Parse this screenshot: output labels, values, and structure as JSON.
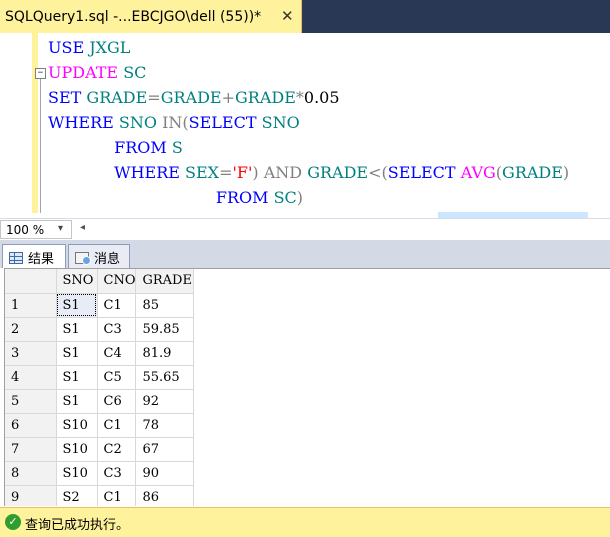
{
  "document_tab": {
    "title": "SQLQuery1.sql -...EBCJGO\\dell (55))*",
    "close_glyph": "✕"
  },
  "editor": {
    "lines": [
      [
        {
          "t": "USE",
          "c": "kw"
        },
        {
          "t": " ",
          "c": "num"
        },
        {
          "t": "JXGL",
          "c": "id"
        }
      ],
      [
        {
          "t": "UPDATE",
          "c": "fn"
        },
        {
          "t": " ",
          "c": "num"
        },
        {
          "t": "SC",
          "c": "id"
        }
      ],
      [
        {
          "t": "SET",
          "c": "kw"
        },
        {
          "t": " ",
          "c": "num"
        },
        {
          "t": "GRADE",
          "c": "id"
        },
        {
          "t": "=",
          "c": "op"
        },
        {
          "t": "GRADE",
          "c": "id"
        },
        {
          "t": "+",
          "c": "op"
        },
        {
          "t": "GRADE",
          "c": "id"
        },
        {
          "t": "*",
          "c": "op"
        },
        {
          "t": "0.05",
          "c": "num"
        }
      ],
      [
        {
          "t": "WHERE",
          "c": "kw"
        },
        {
          "t": " ",
          "c": "num"
        },
        {
          "t": "SNO",
          "c": "id"
        },
        {
          "t": " ",
          "c": "num"
        },
        {
          "t": "IN",
          "c": "op"
        },
        {
          "t": "(",
          "c": "op"
        },
        {
          "t": "SELECT",
          "c": "kw"
        },
        {
          "t": " ",
          "c": "num"
        },
        {
          "t": "SNO",
          "c": "id"
        }
      ],
      [
        {
          "t": "             ",
          "c": "num"
        },
        {
          "t": "FROM",
          "c": "kw"
        },
        {
          "t": " ",
          "c": "num"
        },
        {
          "t": "S",
          "c": "id"
        }
      ],
      [
        {
          "t": "             ",
          "c": "num"
        },
        {
          "t": "WHERE",
          "c": "kw"
        },
        {
          "t": " ",
          "c": "num"
        },
        {
          "t": "SEX",
          "c": "id"
        },
        {
          "t": "=",
          "c": "op"
        },
        {
          "t": "'F'",
          "c": "str"
        },
        {
          "t": ") ",
          "c": "op"
        },
        {
          "t": "AND",
          "c": "op"
        },
        {
          "t": " ",
          "c": "num"
        },
        {
          "t": "GRADE",
          "c": "id"
        },
        {
          "t": "<(",
          "c": "op"
        },
        {
          "t": "SELECT",
          "c": "kw"
        },
        {
          "t": " ",
          "c": "num"
        },
        {
          "t": "AVG",
          "c": "fn"
        },
        {
          "t": "(",
          "c": "op"
        },
        {
          "t": "GRADE",
          "c": "id"
        },
        {
          "t": ")",
          "c": "op"
        }
      ],
      [
        {
          "t": "                                 ",
          "c": "num"
        },
        {
          "t": "FROM",
          "c": "kw"
        },
        {
          "t": " ",
          "c": "num"
        },
        {
          "t": "SC",
          "c": "id"
        },
        {
          "t": ")",
          "c": "op"
        }
      ]
    ],
    "fold_glyph": "−"
  },
  "zoom": {
    "value": "100 %",
    "arrow": "▾",
    "scroll_left": "◂"
  },
  "result_tabs": {
    "results_label": "结果",
    "messages_label": "消息"
  },
  "results_grid": {
    "columns": [
      "SNO",
      "CNO",
      "GRADE"
    ],
    "rows": [
      [
        "1",
        "S1",
        "C1",
        "85"
      ],
      [
        "2",
        "S1",
        "C3",
        "59.85"
      ],
      [
        "3",
        "S1",
        "C4",
        "81.9"
      ],
      [
        "4",
        "S1",
        "C5",
        "55.65"
      ],
      [
        "5",
        "S1",
        "C6",
        "92"
      ],
      [
        "6",
        "S10",
        "C1",
        "78"
      ],
      [
        "7",
        "S10",
        "C2",
        "67"
      ],
      [
        "8",
        "S10",
        "C3",
        "90"
      ],
      [
        "9",
        "S2",
        "C1",
        "86"
      ]
    ]
  },
  "status": {
    "icon_glyph": "✓",
    "text": "查询已成功执行。"
  }
}
